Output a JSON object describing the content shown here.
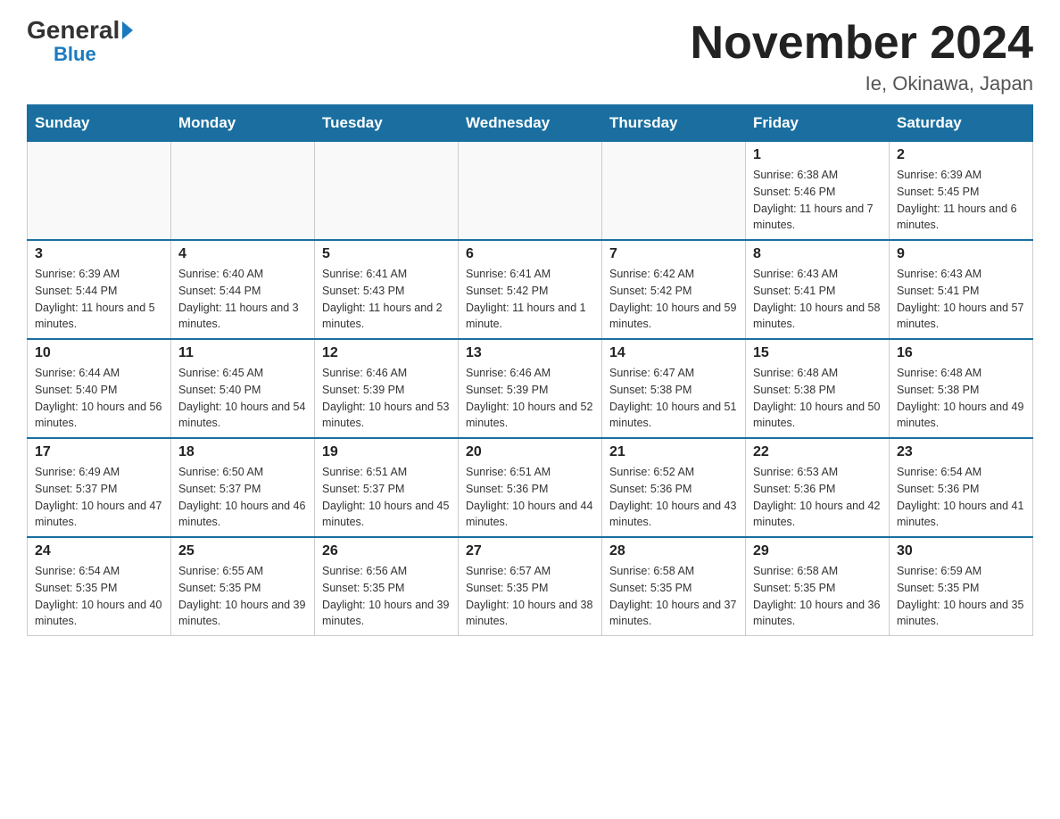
{
  "header": {
    "logo_general": "General",
    "logo_blue": "Blue",
    "month_title": "November 2024",
    "location": "Ie, Okinawa, Japan"
  },
  "days_of_week": [
    "Sunday",
    "Monday",
    "Tuesday",
    "Wednesday",
    "Thursday",
    "Friday",
    "Saturday"
  ],
  "weeks": [
    [
      {
        "day": "",
        "info": ""
      },
      {
        "day": "",
        "info": ""
      },
      {
        "day": "",
        "info": ""
      },
      {
        "day": "",
        "info": ""
      },
      {
        "day": "",
        "info": ""
      },
      {
        "day": "1",
        "info": "Sunrise: 6:38 AM\nSunset: 5:46 PM\nDaylight: 11 hours and 7 minutes."
      },
      {
        "day": "2",
        "info": "Sunrise: 6:39 AM\nSunset: 5:45 PM\nDaylight: 11 hours and 6 minutes."
      }
    ],
    [
      {
        "day": "3",
        "info": "Sunrise: 6:39 AM\nSunset: 5:44 PM\nDaylight: 11 hours and 5 minutes."
      },
      {
        "day": "4",
        "info": "Sunrise: 6:40 AM\nSunset: 5:44 PM\nDaylight: 11 hours and 3 minutes."
      },
      {
        "day": "5",
        "info": "Sunrise: 6:41 AM\nSunset: 5:43 PM\nDaylight: 11 hours and 2 minutes."
      },
      {
        "day": "6",
        "info": "Sunrise: 6:41 AM\nSunset: 5:42 PM\nDaylight: 11 hours and 1 minute."
      },
      {
        "day": "7",
        "info": "Sunrise: 6:42 AM\nSunset: 5:42 PM\nDaylight: 10 hours and 59 minutes."
      },
      {
        "day": "8",
        "info": "Sunrise: 6:43 AM\nSunset: 5:41 PM\nDaylight: 10 hours and 58 minutes."
      },
      {
        "day": "9",
        "info": "Sunrise: 6:43 AM\nSunset: 5:41 PM\nDaylight: 10 hours and 57 minutes."
      }
    ],
    [
      {
        "day": "10",
        "info": "Sunrise: 6:44 AM\nSunset: 5:40 PM\nDaylight: 10 hours and 56 minutes."
      },
      {
        "day": "11",
        "info": "Sunrise: 6:45 AM\nSunset: 5:40 PM\nDaylight: 10 hours and 54 minutes."
      },
      {
        "day": "12",
        "info": "Sunrise: 6:46 AM\nSunset: 5:39 PM\nDaylight: 10 hours and 53 minutes."
      },
      {
        "day": "13",
        "info": "Sunrise: 6:46 AM\nSunset: 5:39 PM\nDaylight: 10 hours and 52 minutes."
      },
      {
        "day": "14",
        "info": "Sunrise: 6:47 AM\nSunset: 5:38 PM\nDaylight: 10 hours and 51 minutes."
      },
      {
        "day": "15",
        "info": "Sunrise: 6:48 AM\nSunset: 5:38 PM\nDaylight: 10 hours and 50 minutes."
      },
      {
        "day": "16",
        "info": "Sunrise: 6:48 AM\nSunset: 5:38 PM\nDaylight: 10 hours and 49 minutes."
      }
    ],
    [
      {
        "day": "17",
        "info": "Sunrise: 6:49 AM\nSunset: 5:37 PM\nDaylight: 10 hours and 47 minutes."
      },
      {
        "day": "18",
        "info": "Sunrise: 6:50 AM\nSunset: 5:37 PM\nDaylight: 10 hours and 46 minutes."
      },
      {
        "day": "19",
        "info": "Sunrise: 6:51 AM\nSunset: 5:37 PM\nDaylight: 10 hours and 45 minutes."
      },
      {
        "day": "20",
        "info": "Sunrise: 6:51 AM\nSunset: 5:36 PM\nDaylight: 10 hours and 44 minutes."
      },
      {
        "day": "21",
        "info": "Sunrise: 6:52 AM\nSunset: 5:36 PM\nDaylight: 10 hours and 43 minutes."
      },
      {
        "day": "22",
        "info": "Sunrise: 6:53 AM\nSunset: 5:36 PM\nDaylight: 10 hours and 42 minutes."
      },
      {
        "day": "23",
        "info": "Sunrise: 6:54 AM\nSunset: 5:36 PM\nDaylight: 10 hours and 41 minutes."
      }
    ],
    [
      {
        "day": "24",
        "info": "Sunrise: 6:54 AM\nSunset: 5:35 PM\nDaylight: 10 hours and 40 minutes."
      },
      {
        "day": "25",
        "info": "Sunrise: 6:55 AM\nSunset: 5:35 PM\nDaylight: 10 hours and 39 minutes."
      },
      {
        "day": "26",
        "info": "Sunrise: 6:56 AM\nSunset: 5:35 PM\nDaylight: 10 hours and 39 minutes."
      },
      {
        "day": "27",
        "info": "Sunrise: 6:57 AM\nSunset: 5:35 PM\nDaylight: 10 hours and 38 minutes."
      },
      {
        "day": "28",
        "info": "Sunrise: 6:58 AM\nSunset: 5:35 PM\nDaylight: 10 hours and 37 minutes."
      },
      {
        "day": "29",
        "info": "Sunrise: 6:58 AM\nSunset: 5:35 PM\nDaylight: 10 hours and 36 minutes."
      },
      {
        "day": "30",
        "info": "Sunrise: 6:59 AM\nSunset: 5:35 PM\nDaylight: 10 hours and 35 minutes."
      }
    ]
  ]
}
